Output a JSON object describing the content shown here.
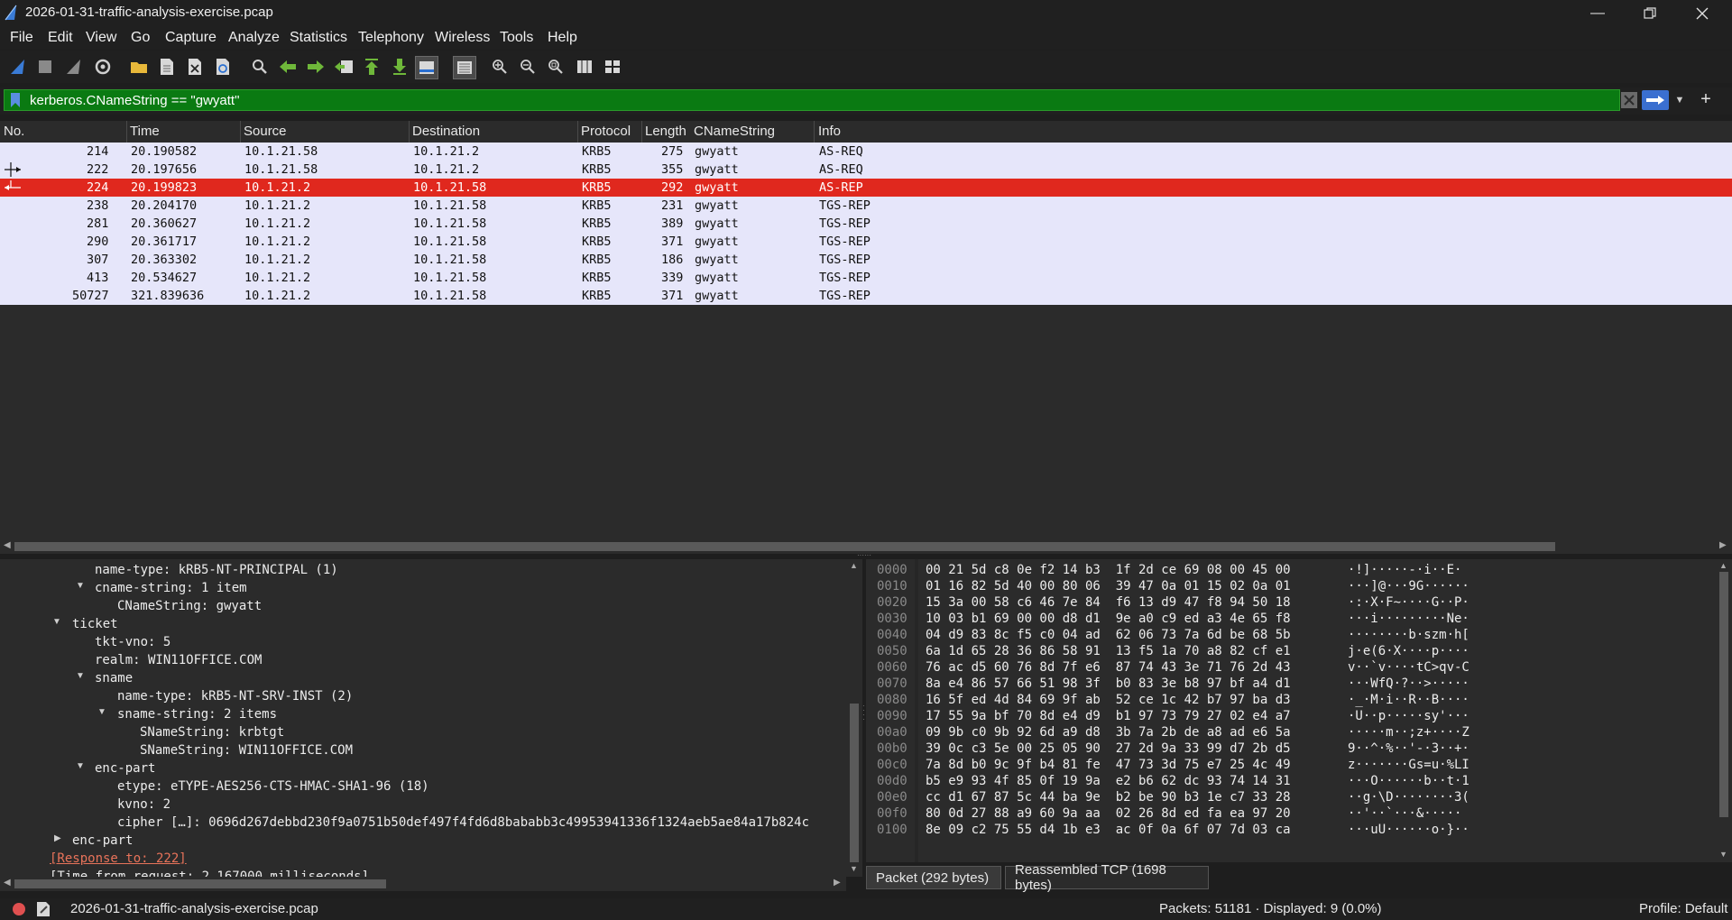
{
  "window": {
    "title": "2026-01-31-traffic-analysis-exercise.pcap"
  },
  "menu": [
    "File",
    "Edit",
    "View",
    "Go",
    "Capture",
    "Analyze",
    "Statistics",
    "Telephony",
    "Wireless",
    "Tools",
    "Help"
  ],
  "filter": {
    "value": "kerberos.CNameString == \"gwyatt\""
  },
  "packet_list": {
    "columns": [
      "No.",
      "Time",
      "Source",
      "Destination",
      "Protocol",
      "Length",
      "CNameString",
      "Info"
    ],
    "rows": [
      {
        "no": "214",
        "time": "20.190582",
        "src": "10.1.21.58",
        "dst": "10.1.21.2",
        "proto": "KRB5",
        "len": "275",
        "cname": "gwyatt",
        "info": "AS-REQ"
      },
      {
        "no": "222",
        "time": "20.197656",
        "src": "10.1.21.58",
        "dst": "10.1.21.2",
        "proto": "KRB5",
        "len": "355",
        "cname": "gwyatt",
        "info": "AS-REQ"
      },
      {
        "no": "224",
        "time": "20.199823",
        "src": "10.1.21.2",
        "dst": "10.1.21.58",
        "proto": "KRB5",
        "len": "292",
        "cname": "gwyatt",
        "info": "AS-REP"
      },
      {
        "no": "238",
        "time": "20.204170",
        "src": "10.1.21.2",
        "dst": "10.1.21.58",
        "proto": "KRB5",
        "len": "231",
        "cname": "gwyatt",
        "info": "TGS-REP"
      },
      {
        "no": "281",
        "time": "20.360627",
        "src": "10.1.21.2",
        "dst": "10.1.21.58",
        "proto": "KRB5",
        "len": "389",
        "cname": "gwyatt",
        "info": "TGS-REP"
      },
      {
        "no": "290",
        "time": "20.361717",
        "src": "10.1.21.2",
        "dst": "10.1.21.58",
        "proto": "KRB5",
        "len": "371",
        "cname": "gwyatt",
        "info": "TGS-REP"
      },
      {
        "no": "307",
        "time": "20.363302",
        "src": "10.1.21.2",
        "dst": "10.1.21.58",
        "proto": "KRB5",
        "len": "186",
        "cname": "gwyatt",
        "info": "TGS-REP"
      },
      {
        "no": "413",
        "time": "20.534627",
        "src": "10.1.21.2",
        "dst": "10.1.21.58",
        "proto": "KRB5",
        "len": "339",
        "cname": "gwyatt",
        "info": "TGS-REP"
      },
      {
        "no": "50727",
        "time": "321.839636",
        "src": "10.1.21.2",
        "dst": "10.1.21.58",
        "proto": "KRB5",
        "len": "371",
        "cname": "gwyatt",
        "info": "TGS-REP"
      }
    ],
    "selected_no": "224"
  },
  "details": [
    "name-type: kRB5-NT-PRINCIPAL (1)",
    "cname-string: 1 item",
    "CNameString: gwyatt",
    "ticket",
    "tkt-vno: 5",
    "realm: WIN11OFFICE.COM",
    "sname",
    "name-type: kRB5-NT-SRV-INST (2)",
    "sname-string: 2 items",
    "SNameString: krbtgt",
    "SNameString: WIN11OFFICE.COM",
    "enc-part",
    "etype: eTYPE-AES256-CTS-HMAC-SHA1-96 (18)",
    "kvno: 2",
    "cipher […]: 0696d267debbd230f9a0751b50def497f4fd6d8bababb3c49953941336f1324aeb5ae84a17b824c",
    "enc-part",
    "[Response to: 222]",
    "[Time from request: 2.167000 milliseconds]"
  ],
  "bytes": [
    {
      "off": "0000",
      "hex": "00 21 5d c8 0e f2 14 b3  1f 2d ce 69 08 00 45 00",
      "asc": "·!]·····-·i··E·"
    },
    {
      "off": "0010",
      "hex": "01 16 82 5d 40 00 80 06  39 47 0a 01 15 02 0a 01",
      "asc": "···]@···9G······"
    },
    {
      "off": "0020",
      "hex": "15 3a 00 58 c6 46 7e 84  f6 13 d9 47 f8 94 50 18",
      "asc": "·:·X·F~····G··P·"
    },
    {
      "off": "0030",
      "hex": "10 03 b1 69 00 00 d8 d1  9e a0 c9 ed a3 4e 65 f8",
      "asc": "···i·········Ne·"
    },
    {
      "off": "0040",
      "hex": "04 d9 83 8c f5 c0 04 ad  62 06 73 7a 6d be 68 5b",
      "asc": "········b·szm·h["
    },
    {
      "off": "0050",
      "hex": "6a 1d 65 28 36 86 58 91  13 f5 1a 70 a8 82 cf e1",
      "asc": "j·e(6·X····p····"
    },
    {
      "off": "0060",
      "hex": "76 ac d5 60 76 8d 7f e6  87 74 43 3e 71 76 2d 43",
      "asc": "v··`v····tC>qv-C"
    },
    {
      "off": "0070",
      "hex": "8a e4 86 57 66 51 98 3f  b0 83 3e b8 97 bf a4 d1",
      "asc": "···WfQ·?··>·····"
    },
    {
      "off": "0080",
      "hex": "16 5f ed 4d 84 69 9f ab  52 ce 1c 42 b7 97 ba d3",
      "asc": "·_·M·i··R··B····"
    },
    {
      "off": "0090",
      "hex": "17 55 9a bf 70 8d e4 d9  b1 97 73 79 27 02 e4 a7",
      "asc": "·U··p·····sy'···"
    },
    {
      "off": "00a0",
      "hex": "09 9b c0 9b 92 6d a9 d8  3b 7a 2b de a8 ad e6 5a",
      "asc": "·····m··;z+····Z"
    },
    {
      "off": "00b0",
      "hex": "39 0c c3 5e 00 25 05 90  27 2d 9a 33 99 d7 2b d5",
      "asc": "9··^·%··'-·3··+·"
    },
    {
      "off": "00c0",
      "hex": "7a 8d b0 9c 9f b4 81 fe  47 73 3d 75 e7 25 4c 49",
      "asc": "z·······Gs=u·%LI"
    },
    {
      "off": "00d0",
      "hex": "b5 e9 93 4f 85 0f 19 9a  e2 b6 62 dc 93 74 14 31",
      "asc": "···O······b··t·1"
    },
    {
      "off": "00e0",
      "hex": "cc d1 67 87 5c 44 ba 9e  b2 be 90 b3 1e c7 33 28",
      "asc": "··g·\\D········3("
    },
    {
      "off": "00f0",
      "hex": "80 0d 27 88 a9 60 9a aa  02 26 8d ed fa ea 97 20",
      "asc": "··'··`···&····· "
    },
    {
      "off": "0100",
      "hex": "8e 09 c2 75 55 d4 1b e3  ac 0f 0a 6f 07 7d 03 ca",
      "asc": "···uU······o·}··"
    }
  ],
  "byte_tabs": [
    "Packet (292 bytes)",
    "Reassembled TCP (1698 bytes)"
  ],
  "status": {
    "file": "2026-01-31-traffic-analysis-exercise.pcap",
    "packets": "Packets: 51181 · Displayed: 9 (0.0%)",
    "profile": "Profile: Default"
  }
}
